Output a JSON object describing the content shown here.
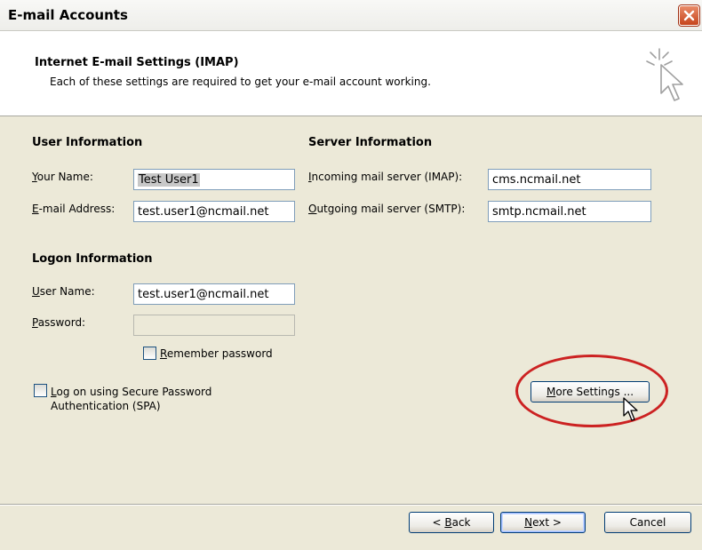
{
  "window": {
    "title": "E-mail Accounts"
  },
  "header": {
    "title": "Internet E-mail Settings (IMAP)",
    "subtitle": "Each of these settings are required to get your e-mail account working."
  },
  "user_info": {
    "heading": "User Information",
    "name_label_u": "Y",
    "name_label_rest": "our Name:",
    "name_value": "Test User1",
    "email_label_u": "E",
    "email_label_rest": "-mail Address:",
    "email_value": "test.user1@ncmail.net"
  },
  "server_info": {
    "heading": "Server Information",
    "incoming_label_u": "I",
    "incoming_label_rest": "ncoming mail server (IMAP):",
    "incoming_value": "cms.ncmail.net",
    "outgoing_label_u": "O",
    "outgoing_label_rest": "utgoing mail server (SMTP):",
    "outgoing_value": "smtp.ncmail.net"
  },
  "logon_info": {
    "heading": "Logon Information",
    "username_label_u": "U",
    "username_label_rest": "ser Name:",
    "username_value": "test.user1@ncmail.net",
    "password_label_u": "P",
    "password_label_rest": "assword:",
    "password_value": "",
    "remember_u": "R",
    "remember_rest": "emember password",
    "spa_u": "L",
    "spa_rest_line1": "og on using Secure Password",
    "spa_line2": "Authentication (SPA)"
  },
  "buttons": {
    "more_settings_u": "M",
    "more_settings_rest": "ore Settings ...",
    "back_prefix": "< ",
    "back_u": "B",
    "back_rest": "ack",
    "next_u": "N",
    "next_rest": "ext >",
    "cancel": "Cancel"
  },
  "colors": {
    "highlight_circle": "#cc2222",
    "dialog_bg": "#ece9d8"
  }
}
